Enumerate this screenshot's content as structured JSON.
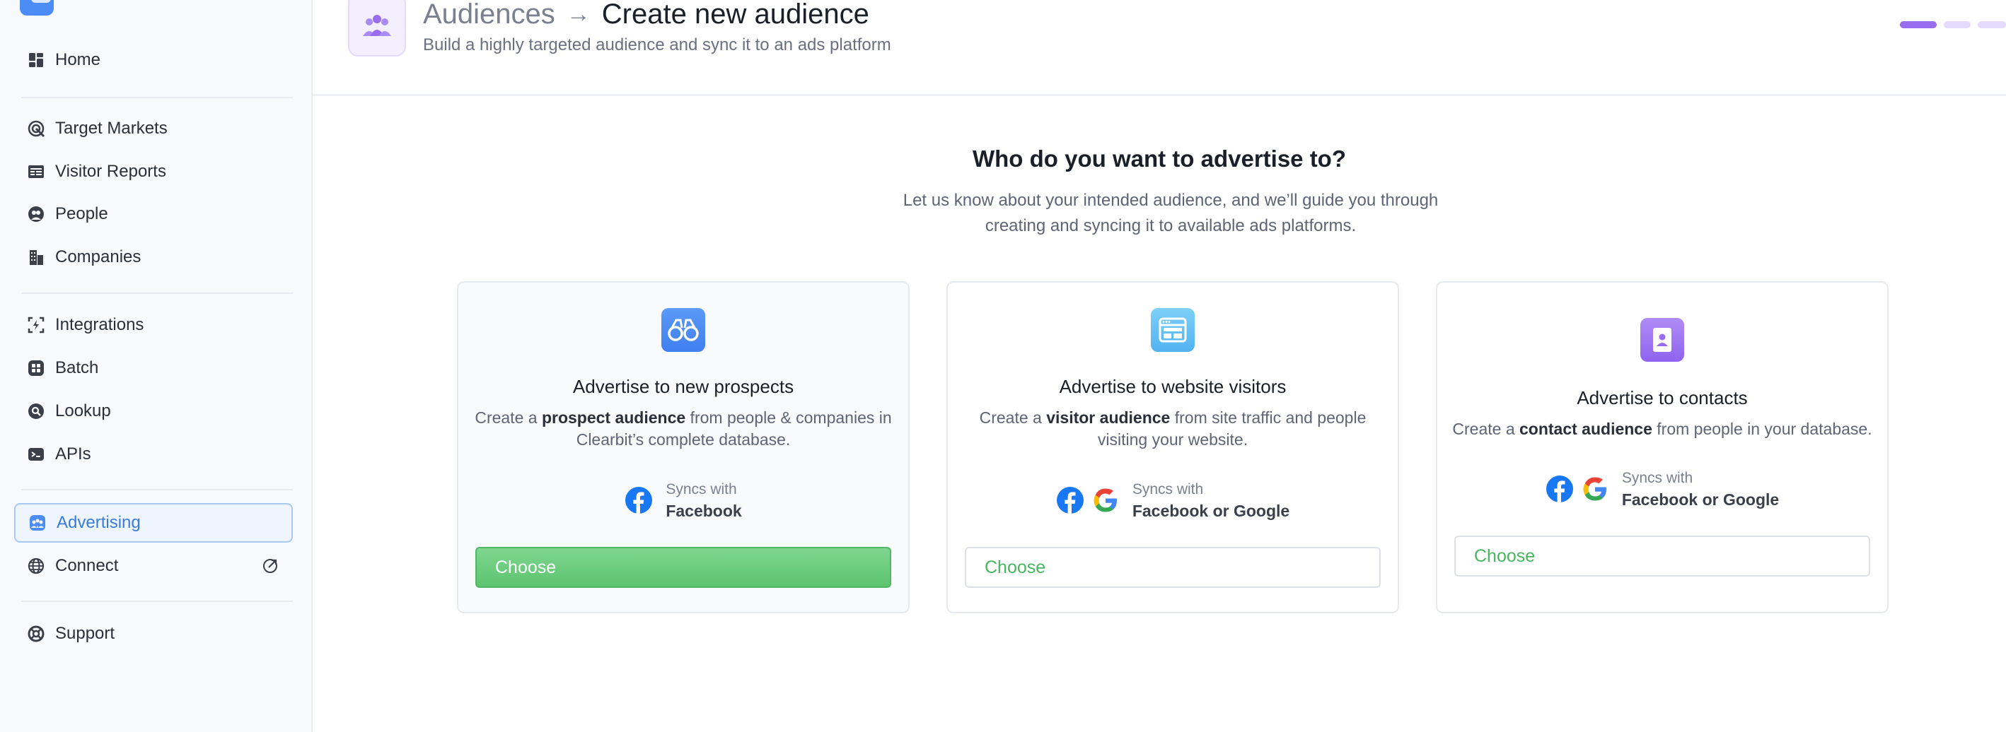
{
  "sidebar": {
    "items": [
      {
        "label": "Home",
        "icon": "dashboard-icon"
      },
      {
        "label": "Target Markets",
        "icon": "target-icon"
      },
      {
        "label": "Visitor Reports",
        "icon": "report-icon"
      },
      {
        "label": "People",
        "icon": "person-icon"
      },
      {
        "label": "Companies",
        "icon": "building-icon"
      },
      {
        "label": "Integrations",
        "icon": "integrations-icon"
      },
      {
        "label": "Batch",
        "icon": "batch-icon"
      },
      {
        "label": "Lookup",
        "icon": "lookup-icon"
      },
      {
        "label": "APIs",
        "icon": "terminal-icon"
      },
      {
        "label": "Advertising",
        "icon": "audience-icon",
        "active": true
      },
      {
        "label": "Connect",
        "icon": "globe-icon"
      },
      {
        "label": "Support",
        "icon": "lifebuoy-icon"
      }
    ]
  },
  "header": {
    "parent": "Audiences",
    "arrow": "→",
    "current": "Create new audience",
    "subtitle": "Build a highly targeted audience and sync it to an ads platform"
  },
  "main": {
    "question": "Who do you want to advertise to?",
    "question_sub": "Let us know about your intended audience, and we’ll guide you through creating and syncing it to available ads platforms.",
    "cards": [
      {
        "title": "Advertise to new prospects",
        "desc_pre": "Create a ",
        "desc_bold": "prospect audience",
        "desc_post": " from people & companies in Clearbit’s complete database.",
        "sync_label": "Syncs with",
        "sync_platform": "Facebook",
        "choose_label": "Choose",
        "icon": "binoculars-icon"
      },
      {
        "title": "Advertise to website visitors",
        "desc_pre": "Create a ",
        "desc_bold": "visitor audience",
        "desc_post": " from site traffic and people visiting your website.",
        "sync_label": "Syncs with",
        "sync_platform": "Facebook or Google",
        "choose_label": "Choose",
        "icon": "browser-window-icon"
      },
      {
        "title": "Advertise to contacts",
        "desc_pre": "Create a ",
        "desc_bold": "contact audience",
        "desc_post": " from people in your database.",
        "sync_label": "Syncs with",
        "sync_platform": "Facebook or Google",
        "choose_label": "Choose",
        "icon": "contact-book-icon"
      }
    ]
  },
  "colors": {
    "accent_blue": "#3a7be0",
    "accent_purple": "#9a6cf0",
    "choose_green": "#5cc46f"
  }
}
